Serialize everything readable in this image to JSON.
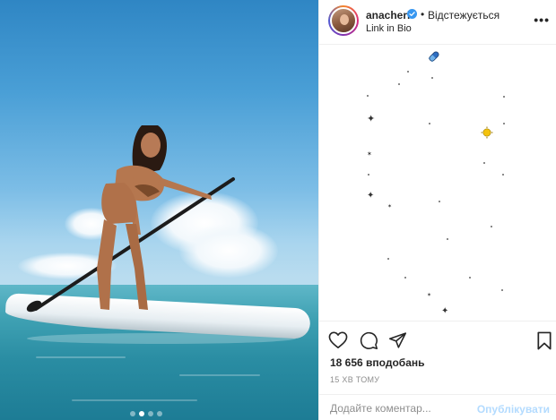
{
  "post": {
    "dots_count": 4,
    "active_dot": 1
  },
  "header": {
    "username": "anacheri",
    "separator": "•",
    "follow_label": "Відстежується",
    "subline": "Link in Bio",
    "more_label": "•••"
  },
  "comments": {
    "decorations": [
      "sparkle-icon",
      "sun-icon",
      "pill-icon",
      "star-icon"
    ]
  },
  "actions": {
    "likes": "18 656 вподобань",
    "time": "15 ХВ ТОМУ"
  },
  "composer": {
    "placeholder": "Додайте коментар...",
    "publish_label": "Опублікувати"
  },
  "colors": {
    "verified": "#3897f0",
    "publish_disabled": "#b3dbff",
    "sky": "#4a9fd6",
    "sea": "#2a8da3"
  }
}
